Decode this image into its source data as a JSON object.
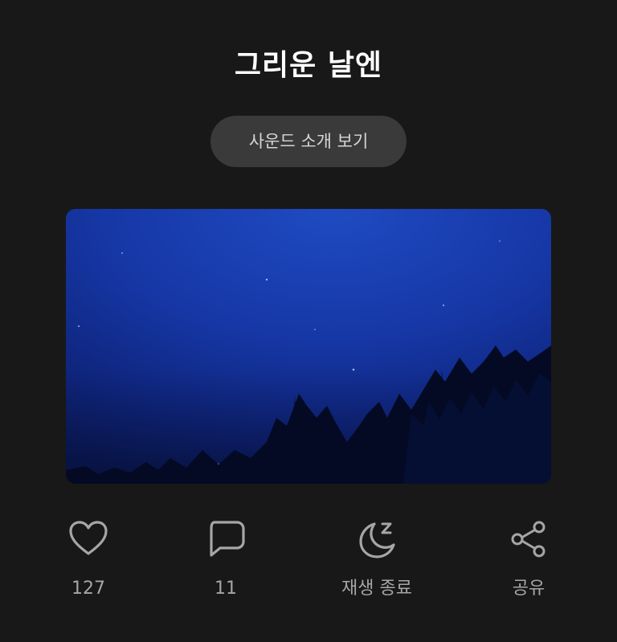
{
  "sound": {
    "title": "그리운 날엔",
    "intro_button_label": "사운드 소개 보기"
  },
  "actions": {
    "like": {
      "icon": "heart-icon",
      "label": "127"
    },
    "comment": {
      "icon": "comment-icon",
      "label": "11"
    },
    "sleep_timer": {
      "icon": "moon-sleep-icon",
      "label": "재생 종료"
    },
    "share": {
      "icon": "share-icon",
      "label": "공유"
    }
  },
  "colors": {
    "background": "#181818",
    "button_background": "#3a3a3a",
    "icon": "#a6a6a6",
    "title": "#ffffff"
  }
}
